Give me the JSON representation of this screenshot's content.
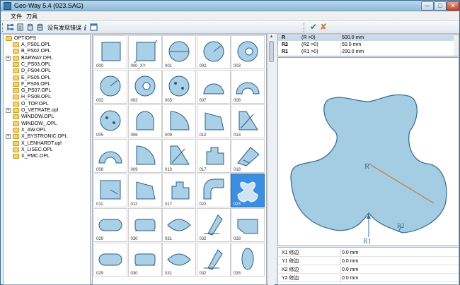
{
  "window": {
    "title": "Geo-Way 5.4 (023.SAG)",
    "min_glyph": "─",
    "max_glyph": "□",
    "close_glyph": "✕"
  },
  "menu": {
    "file": "文件",
    "tool": "刀具"
  },
  "toolbar": {
    "status_text": "没有发现错误",
    "ok_glyph": "✔",
    "cancel_glyph": "✘"
  },
  "tree": {
    "root": "OPTIOPS",
    "items": [
      "A_PS01.OPL",
      "B_PS02.OPL",
      "BARWAY.OPL",
      "C_PS03.OPL",
      "D_PS04.OPL",
      "E_PS05.OPL",
      "F_PS06.OPL",
      "G_PS07.OPL",
      "H_PS08.OPL",
      "O_TOP.OPL",
      "O_VETRATE.opl",
      "WINDOW.OPL",
      "WINDOW_.OPL",
      "X_AW.OPL",
      "X_BYSTRONIC.OPL",
      "X_LENHARDT.opl",
      "X_LISEC.OPL",
      "X_PMC.OPL"
    ],
    "expandable": [
      2,
      10,
      14
    ]
  },
  "gallery": {
    "rows": [
      [
        "000",
        "000_XY",
        "001",
        "002",
        "003"
      ],
      [
        "002",
        "003",
        "005",
        "007",
        "008"
      ],
      [
        "005",
        "006",
        "009",
        "012",
        "013"
      ],
      [
        "008",
        "009",
        "013",
        "017",
        "018"
      ],
      [
        "011",
        "012",
        "017",
        "022",
        "023"
      ],
      [
        "029",
        "030",
        "031",
        "032",
        "028"
      ],
      [
        "029",
        "030",
        "031",
        "032",
        "033"
      ]
    ],
    "selected": "023"
  },
  "params": [
    {
      "name": "R",
      "cond": "(R >0)",
      "value": "500.0 mm",
      "selected": true
    },
    {
      "name": "R2",
      "cond": "(R2 >0)",
      "value": "50.0 mm",
      "selected": false
    },
    {
      "name": "R1",
      "cond": "(R1 >0)",
      "value": "200.0 mm",
      "selected": false
    }
  ],
  "preview": {
    "label_r": "R",
    "label_r1": "R1",
    "label_r2": "R2",
    "shape_fill": "#a4cde3",
    "shape_stroke": "#3c6f96",
    "radius_line": "#c9793a"
  },
  "props": [
    {
      "name": "X1 修边",
      "value": "0.0 mm"
    },
    {
      "name": "Y1 修边",
      "value": "0.0 mm"
    },
    {
      "name": "X2 修边",
      "value": "0.0 mm"
    },
    {
      "name": "Y2 修边",
      "value": "0.0 mm"
    }
  ]
}
